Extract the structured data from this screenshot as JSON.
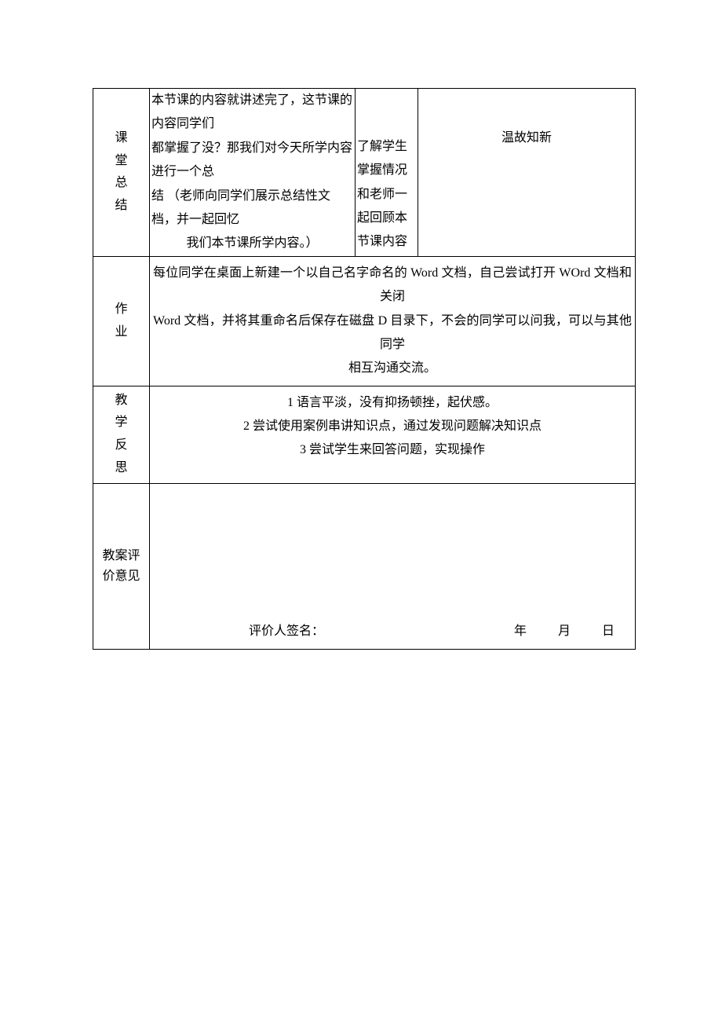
{
  "rows": {
    "summary": {
      "label_chars": [
        "课",
        "堂",
        "总",
        "结"
      ],
      "main_text_lines": [
        "本节课的内容就讲述完了，这节课的内容同学们",
        "都掌握了没？那我们对今天所学内容进行一个总",
        "结 （老师向同学们展示总结性文档，并一起回忆"
      ],
      "main_text_last_line": "我们本节课所学内容。）",
      "student_col": "了解学生掌握情况和老师一起回顾本节课内容",
      "note_col": "温故知新"
    },
    "homework": {
      "label_chars": [
        "作",
        "业"
      ],
      "body_lines": [
        "每位同学在桌面上新建一个以自己名字命名的 Word 文档，自己尝试打开 WOrd 文档和关闭",
        "Word 文档，并将其重命名后保存在磁盘 D 目录下，不会的同学可以问我，可以与其他同学"
      ],
      "body_last": "相互沟通交流。"
    },
    "reflection": {
      "label_chars": [
        "教",
        "学",
        "反",
        "思"
      ],
      "lines": [
        "1 语言平淡，没有抑扬顿挫，起伏感。",
        "2 尝试使用案例串讲知识点，通过发现问题解决知识点",
        "3 尝试学生来回答问题，实现操作"
      ]
    },
    "evaluation": {
      "label_lines": [
        "教案评",
        "价意见"
      ],
      "signature_label": "评价人签名：",
      "date_parts": [
        "年",
        "月",
        "日"
      ]
    }
  }
}
